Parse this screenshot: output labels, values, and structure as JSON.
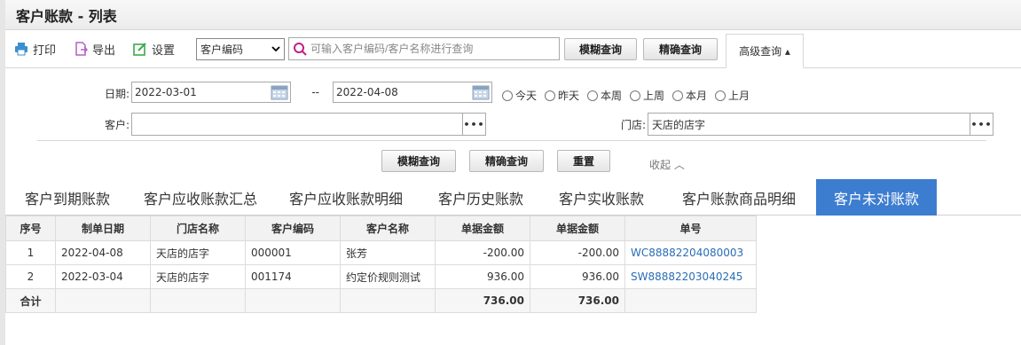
{
  "window": {
    "title": "客户账款 - 列表"
  },
  "toolbar": {
    "print": "打印",
    "export": "导出",
    "settings": "设置",
    "search_field_select": "客户编码",
    "search_placeholder": "可输入客户编码/客户名称进行查询",
    "fuzzy_query": "模糊查询",
    "exact_query": "精确查询",
    "advanced_query": "高级查询 ▴"
  },
  "filters": {
    "date_label": "日期:",
    "date_from": "2022-03-01",
    "date_sep": "--",
    "date_to": "2022-04-08",
    "ranges": [
      "今天",
      "昨天",
      "本周",
      "上周",
      "本月",
      "上月"
    ],
    "customer_label": "客户:",
    "customer_value": "",
    "store_label": "门店:",
    "store_value": "天店的店字",
    "fuzzy_query": "模糊查询",
    "exact_query": "精确查询",
    "reset": "重置",
    "collapse": "收起 ︿"
  },
  "tabs": [
    "客户到期账款",
    "客户应收账款汇总",
    "客户应收账款明细",
    "客户历史账款",
    "客户实收账款",
    "客户账款商品明细",
    "客户未对账款"
  ],
  "active_tab": 6,
  "table": {
    "headers": [
      "序号",
      "制单日期",
      "门店名称",
      "客户编码",
      "客户名称",
      "单据金额",
      "单据金额",
      "单号"
    ],
    "rows": [
      [
        "1",
        "2022-04-08",
        "天店的店字",
        "000001",
        "张芳",
        "-200.00",
        "-200.00",
        "WC88882204080003"
      ],
      [
        "2",
        "2022-03-04",
        "天店的店字",
        "001174",
        "约定价规则测试",
        "936.00",
        "936.00",
        "SW88882203040245"
      ]
    ],
    "total": {
      "label": "合计",
      "amount1": "736.00",
      "amount2": "736.00"
    }
  },
  "colors": {
    "accent": "#3d7dd0",
    "link": "#2a6db5",
    "icon_print": "#3b8fcf",
    "icon_export": "#b55ec9",
    "icon_settings": "#3ea84b",
    "icon_search": "#c0208a"
  }
}
